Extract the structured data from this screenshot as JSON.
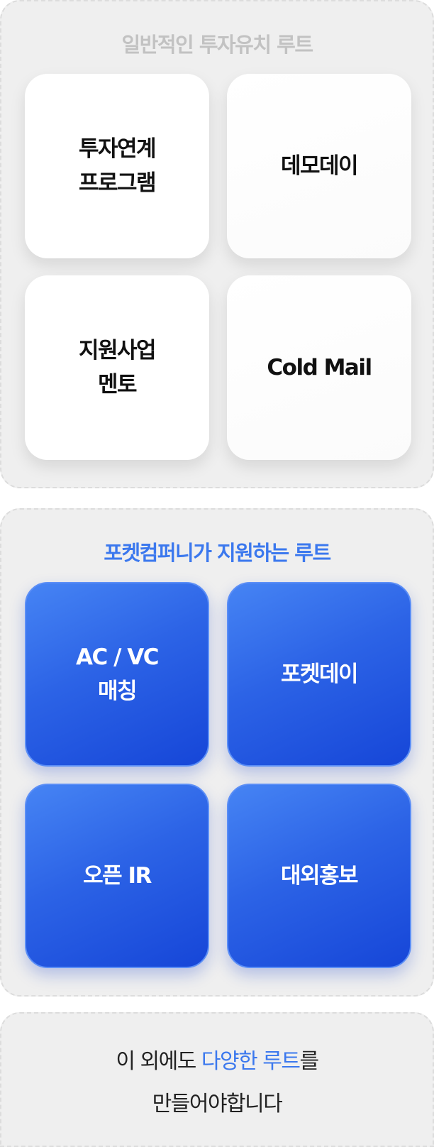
{
  "colors": {
    "panel_background": "#efefef",
    "general_title": "#c2c2c2",
    "accent_blue": "#3b78ee",
    "card_white": "#ffffff",
    "card_blue_start": "#4684f4",
    "card_blue_end": "#1646d8"
  },
  "general_routes": {
    "title": "일반적인 투자유치 루트",
    "cards": [
      {
        "label": "투자연계\n프로그램"
      },
      {
        "label": "데모데이"
      },
      {
        "label": "지원사업\n멘토"
      },
      {
        "label": "Cold Mail"
      }
    ]
  },
  "pocket_routes": {
    "title": "포켓컴퍼니가 지원하는 루트",
    "cards": [
      {
        "label": "AC / VC\n매칭"
      },
      {
        "label": "포켓데이"
      },
      {
        "label": "오픈 IR"
      },
      {
        "label": "대외홍보"
      }
    ]
  },
  "closing": {
    "line1_prefix": "이 외에도 ",
    "line1_accent": "다양한 루트",
    "line1_suffix": "를",
    "line2": "만들어야합니다"
  }
}
